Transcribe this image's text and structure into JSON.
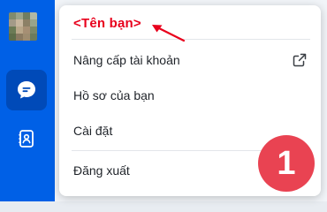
{
  "user_menu": {
    "profile_name": "<Tên bạn>",
    "items": [
      {
        "label": "Nâng cấp tài khoản",
        "icon": "external-link-icon"
      },
      {
        "label": "Hồ sơ của bạn"
      },
      {
        "label": "Cài đặt"
      },
      {
        "label": "Đăng xuất"
      }
    ]
  },
  "annotation": {
    "step_number": "1"
  },
  "colors": {
    "sidebar": "#0060e6",
    "sidebar_active": "#004ab8",
    "header_text": "#e8001c",
    "badge": "#e94352"
  },
  "sidebar": {
    "icons": [
      "avatar",
      "chat-icon",
      "contacts-icon"
    ]
  }
}
